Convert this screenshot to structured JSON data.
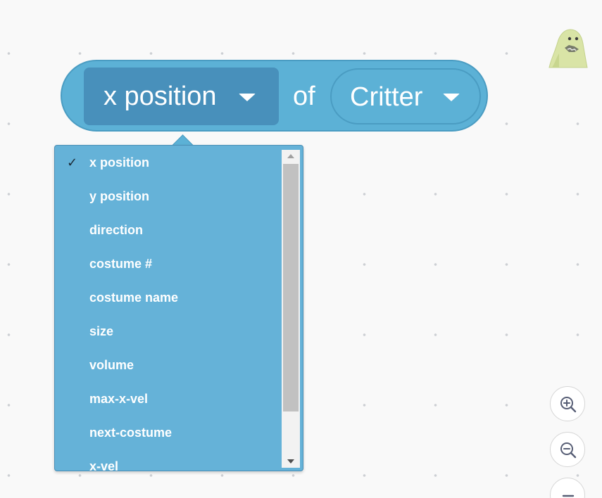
{
  "block": {
    "property_selected": "x position",
    "of_label": "of",
    "sprite_selected": "Critter"
  },
  "menu": {
    "items": [
      {
        "label": "x position",
        "checked": true
      },
      {
        "label": "y position",
        "checked": false
      },
      {
        "label": "direction",
        "checked": false
      },
      {
        "label": "costume #",
        "checked": false
      },
      {
        "label": "costume name",
        "checked": false
      },
      {
        "label": "size",
        "checked": false
      },
      {
        "label": "volume",
        "checked": false
      },
      {
        "label": "max-x-vel",
        "checked": false
      },
      {
        "label": "next-costume",
        "checked": false
      },
      {
        "label": "x-vel",
        "checked": false
      }
    ],
    "check_mark": "✓"
  },
  "zoom_controls": [
    "zoom-in-icon",
    "zoom-out-icon",
    "zoom-reset-icon"
  ],
  "colors": {
    "block": "#5cb1d6",
    "block_border": "#4a9cc2",
    "dropdown_selected": "#4890bb",
    "menu_bg": "#65b2d8",
    "workspace_bg": "#f9f9f9"
  }
}
